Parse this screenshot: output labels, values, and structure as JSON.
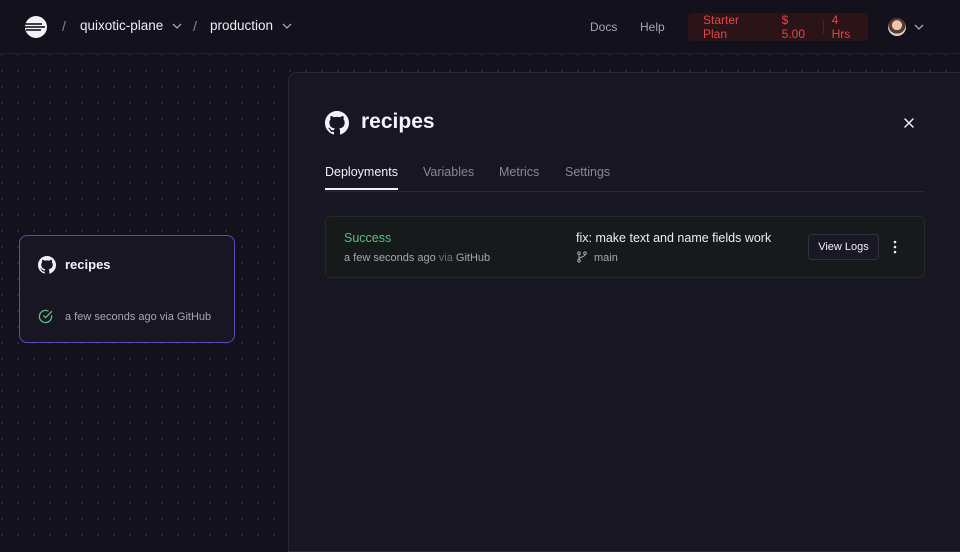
{
  "header": {
    "project": "quixotic-plane",
    "environment": "production",
    "separator": "/",
    "docs_label": "Docs",
    "help_label": "Help",
    "plan": {
      "name": "Starter Plan",
      "cost": "$ 5.00",
      "hours": "4 Hrs"
    }
  },
  "canvas": {
    "service": {
      "name": "recipes",
      "status_text": "a few seconds ago via GitHub"
    }
  },
  "panel": {
    "title": "recipes",
    "tabs": [
      {
        "label": "Deployments",
        "active": true
      },
      {
        "label": "Variables",
        "active": false
      },
      {
        "label": "Metrics",
        "active": false
      },
      {
        "label": "Settings",
        "active": false
      }
    ],
    "deployment": {
      "status": "Success",
      "time": "a few seconds ago",
      "via": "via",
      "source": "GitHub",
      "commit_message": "fix: make text and name fields work",
      "branch": "main",
      "view_logs_label": "View Logs"
    }
  },
  "colors": {
    "accent_purple": "#6b44b8",
    "success_green": "#5ebd7f",
    "plan_red": "#e0464a"
  }
}
